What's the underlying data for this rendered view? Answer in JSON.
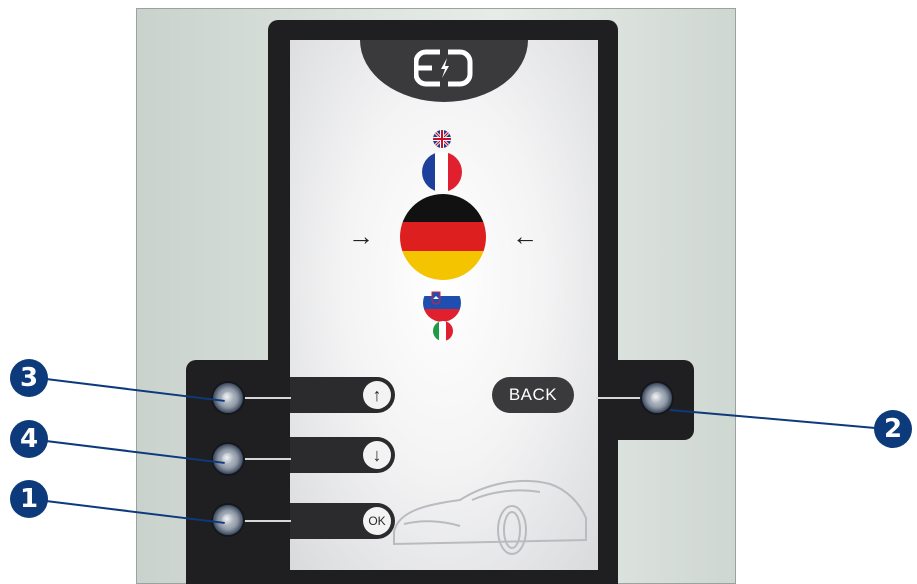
{
  "screen": {
    "logo": {
      "name": "ed-logo",
      "text": ""
    },
    "languages": [
      {
        "code": "en",
        "flag": "uk-flag"
      },
      {
        "code": "fr",
        "flag": "france-flag"
      },
      {
        "code": "de",
        "flag": "germany-flag",
        "selected": true
      },
      {
        "code": "sl",
        "flag": "slovenia-flag"
      },
      {
        "code": "it",
        "flag": "italy-flag"
      }
    ],
    "selector_arrows": {
      "left": "→",
      "right": "←"
    },
    "buttons": {
      "up_icon": "↑",
      "down_icon": "↓",
      "ok_label": "OK",
      "back_label": "BACK"
    },
    "decoration": "car-outline"
  },
  "callouts": {
    "up": "3",
    "down": "4",
    "ok": "1",
    "back": "2"
  },
  "colors": {
    "bezel": "#1f1f22",
    "callout": "#0d3a7a",
    "pill": "#2b2b2e",
    "screen_bg": "#f4f4f5"
  }
}
